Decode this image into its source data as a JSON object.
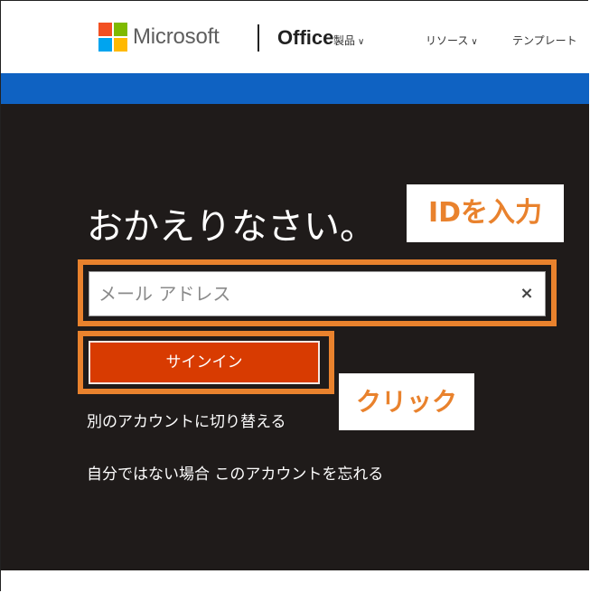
{
  "header": {
    "brand": "Microsoft",
    "product": "Office",
    "nav": [
      {
        "label": "製品"
      },
      {
        "label": "リソース"
      },
      {
        "label": "テンプレート"
      }
    ],
    "logo_colors": [
      "#f25022",
      "#7fba00",
      "#00a4ef",
      "#ffb900"
    ]
  },
  "main": {
    "welcome": "おかえりなさい。",
    "email_placeholder": "メール アドレス",
    "email_value": "",
    "clear_icon": "×",
    "signin_label": "サインイン",
    "switch_account_link": "別のアカウントに切り替える",
    "forget_account_link": "自分ではない場合 このアカウントを忘れる"
  },
  "annotations": {
    "id_callout": "IDを入力",
    "click_callout": "クリック"
  },
  "colors": {
    "accent_blue": "#0f62c2",
    "signin_orange": "#d83b01",
    "highlight_orange": "#e9822d",
    "dark_bg": "#1f1b1a"
  }
}
